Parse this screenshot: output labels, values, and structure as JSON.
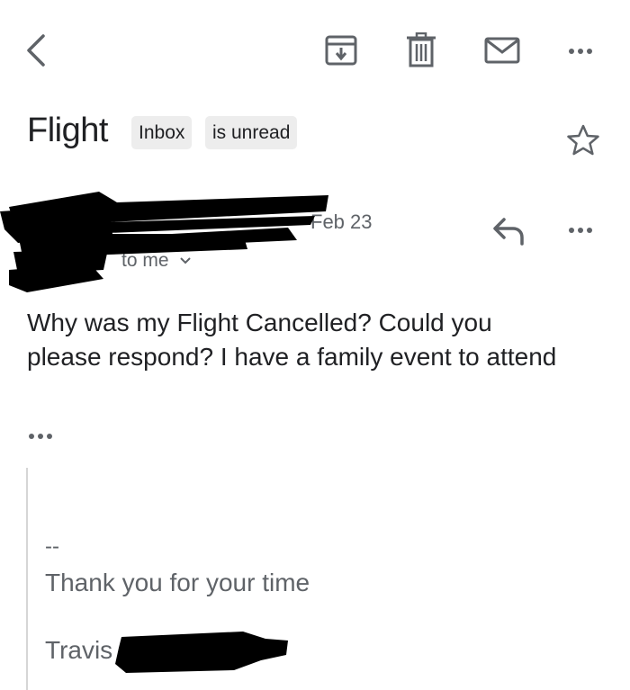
{
  "toolbar": {
    "back_icon": "chevron-left-icon",
    "archive_icon": "archive-icon",
    "delete_icon": "trash-icon",
    "mark_unread_icon": "mail-icon",
    "more_icon": "more-horizontal-icon"
  },
  "email": {
    "subject": "Flight",
    "labels": [
      "Inbox",
      "is unread"
    ],
    "star_icon": "star-outline-icon",
    "date": "Feb 23",
    "recipient": "to me",
    "reply_icon": "reply-icon",
    "body": "Why was my Flight Cancelled? Could you please respond? I have a family event to attend",
    "quoted": {
      "separator": "--",
      "line": "Thank you for your time",
      "signature": "Travis"
    }
  },
  "colors": {
    "text": "#202124",
    "muted": "#5f6368",
    "chip": "#ededed",
    "redaction": "#000000"
  }
}
